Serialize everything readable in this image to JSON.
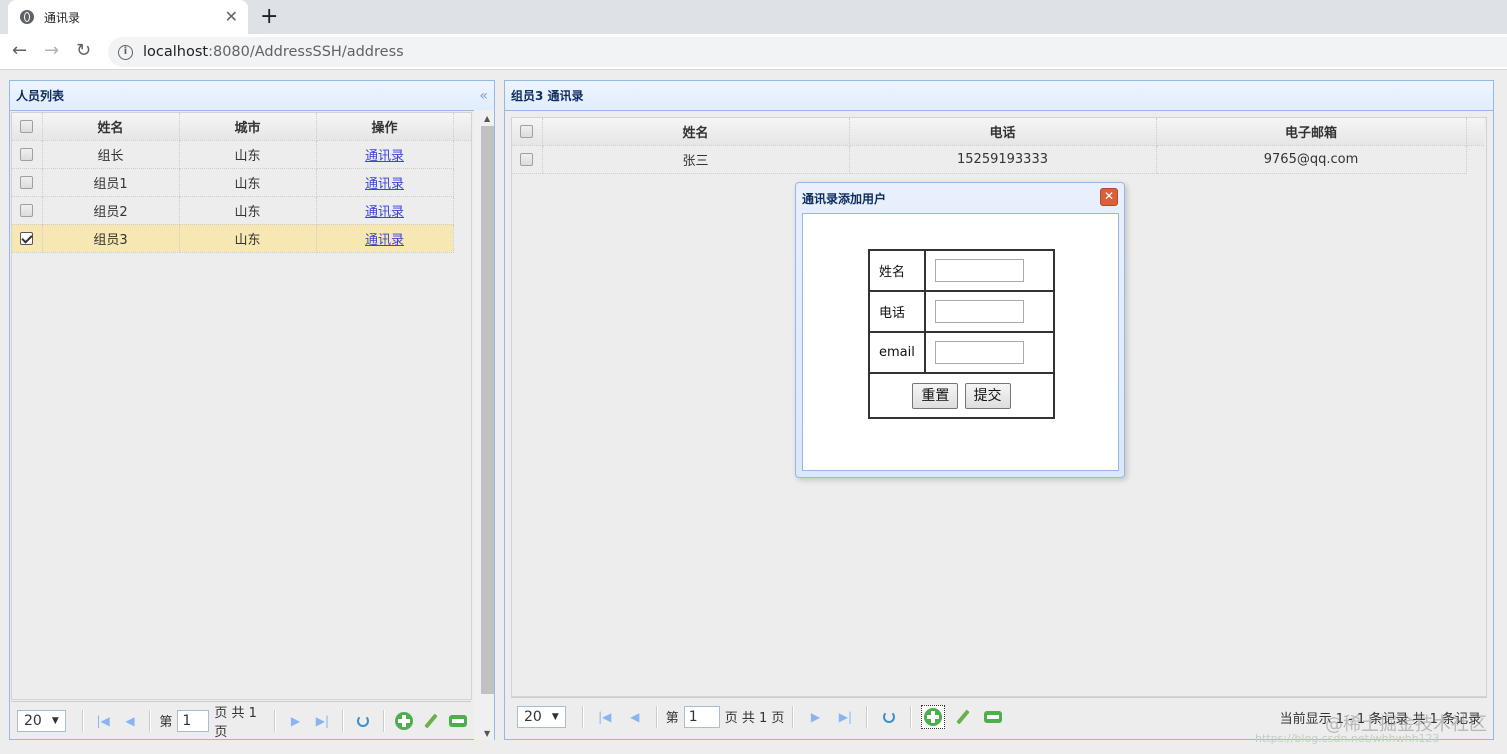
{
  "browser": {
    "tab_title": "通讯录",
    "tab_close": "✕",
    "new_tab": "+",
    "url_host": "localhost",
    "url_rest": ":8080/AddressSSH/address"
  },
  "left_panel": {
    "title": "人员列表",
    "collapse_glyph": "«",
    "columns": [
      "姓名",
      "城市",
      "操作"
    ],
    "rows": [
      {
        "name": "组长",
        "city": "山东",
        "action": "通讯录",
        "checked": false
      },
      {
        "name": "组员1",
        "city": "山东",
        "action": "通讯录",
        "checked": false
      },
      {
        "name": "组员2",
        "city": "山东",
        "action": "通讯录",
        "checked": false
      },
      {
        "name": "组员3",
        "city": "山东",
        "action": "通讯录",
        "checked": true
      }
    ],
    "pager": {
      "page_size": "20",
      "page_prefix": "第",
      "page_value": "1",
      "page_suffix": "页 共 1 页"
    }
  },
  "right_panel": {
    "title": "组员3 通讯录",
    "columns": [
      "姓名",
      "电话",
      "电子邮箱"
    ],
    "rows": [
      {
        "name": "张三",
        "phone": "15259193333",
        "email": "9765@qq.com",
        "checked": false
      }
    ],
    "pager": {
      "page_size": "20",
      "page_prefix": "第",
      "page_value": "1",
      "page_suffix": "页 共 1 页",
      "info": "当前显示 1 - 1 条记录 共 1 条记录"
    }
  },
  "dialog": {
    "title": "通讯录添加用户",
    "close_glyph": "✕",
    "fields": [
      {
        "label": "姓名",
        "value": ""
      },
      {
        "label": "电话",
        "value": ""
      },
      {
        "label": "email",
        "value": ""
      }
    ],
    "reset_label": "重置",
    "submit_label": "提交"
  },
  "watermark": {
    "text1": "@稀土掘金技术社区",
    "text2": "https://blog.csdn.net/whhwhh123"
  },
  "colors": {
    "panel_border": "#95b8e7",
    "selected_row": "#f7e7b2",
    "link": "#3b44d8",
    "close_button": "#d9603b"
  }
}
